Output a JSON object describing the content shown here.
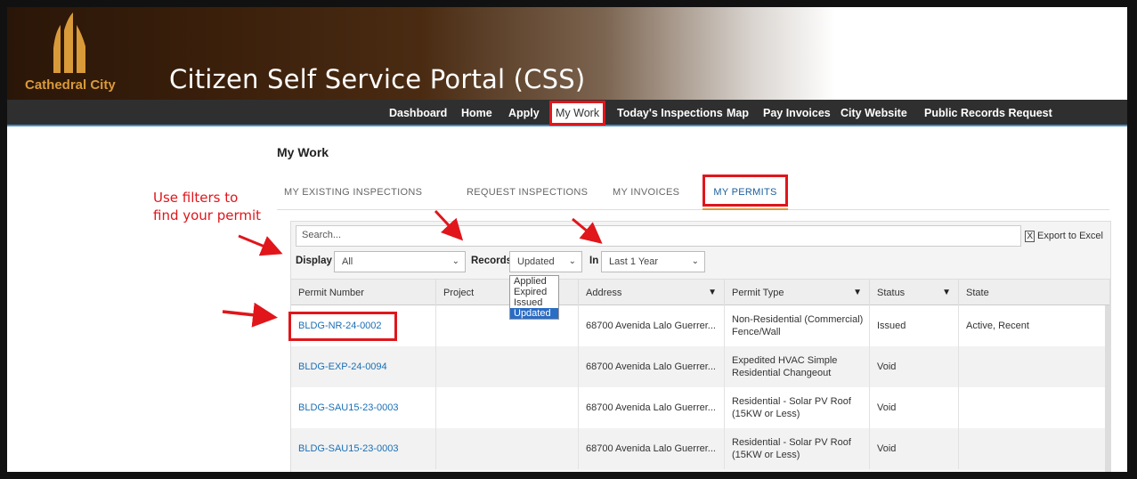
{
  "header": {
    "logo_text": "Cathedral City",
    "portal_title": "Citizen Self Service Portal (CSS)"
  },
  "nav": {
    "items": [
      {
        "label": "Dashboard"
      },
      {
        "label": "Home"
      },
      {
        "label": "Apply"
      },
      {
        "label": "My Work"
      },
      {
        "label": "Today's Inspections"
      },
      {
        "label": "Map"
      },
      {
        "label": "Pay Invoices"
      },
      {
        "label": "City Website"
      },
      {
        "label": "Public Records Request"
      }
    ]
  },
  "main": {
    "title": "My Work",
    "tabs": [
      {
        "label": "MY EXISTING INSPECTIONS"
      },
      {
        "label": "REQUEST INSPECTIONS"
      },
      {
        "label": "MY INVOICES"
      },
      {
        "label": "MY PERMITS"
      }
    ]
  },
  "annotation": {
    "line1": "Use filters to",
    "line2": "find your permit"
  },
  "toolbar": {
    "search_placeholder": "Search...",
    "export_label": "Export to Excel"
  },
  "filters": {
    "display_label": "Display",
    "display_value": "All",
    "records_label": "Records",
    "records_value": "Updated",
    "records_options": [
      "Applied",
      "Expired",
      "Issued",
      "Updated"
    ],
    "in_label": "In",
    "in_value": "Last 1 Year"
  },
  "table": {
    "columns": [
      "Permit Number",
      "Project",
      "Address",
      "Permit Type",
      "Status",
      "State"
    ],
    "rows": [
      {
        "permit": "BLDG-NR-24-0002",
        "project": "",
        "address": "68700 Avenida Lalo Guerrer...",
        "type": "Non-Residential (Commercial) Fence/Wall",
        "status": "Issued",
        "state": "Active, Recent"
      },
      {
        "permit": "BLDG-EXP-24-0094",
        "project": "",
        "address": "68700 Avenida Lalo Guerrer...",
        "type": "Expedited HVAC Simple Residential Changeout",
        "status": "Void",
        "state": ""
      },
      {
        "permit": "BLDG-SAU15-23-0003",
        "project": "",
        "address": "68700 Avenida Lalo Guerrer...",
        "type": "Residential - Solar PV Roof (15KW or Less)",
        "status": "Void",
        "state": ""
      },
      {
        "permit": "BLDG-SAU15-23-0003",
        "project": "",
        "address": "68700 Avenida Lalo Guerrer...",
        "type": "Residential - Solar PV Roof (15KW or Less)",
        "status": "Void",
        "state": ""
      }
    ]
  },
  "colors": {
    "accent": "#e0161b",
    "link": "#1a6fb5",
    "logo": "#d99a3a",
    "nav_bg": "#2f2f2f"
  }
}
